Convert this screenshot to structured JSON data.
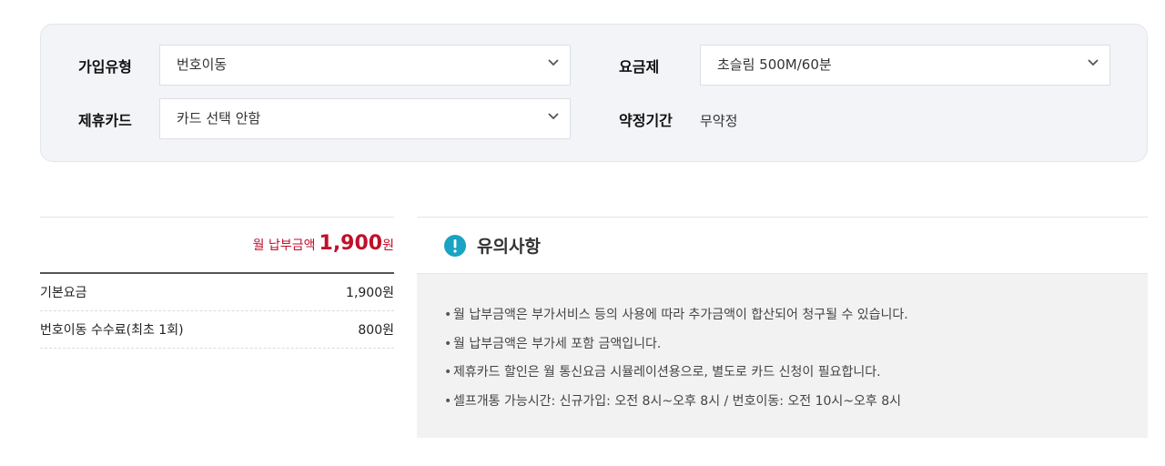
{
  "filters": {
    "join_type": {
      "label": "가입유형",
      "value": "번호이동"
    },
    "plan": {
      "label": "요금제",
      "value": "초슬림 500M/60분"
    },
    "card": {
      "label": "제휴카드",
      "value": "카드 선택 안함"
    },
    "contract": {
      "label": "약정기간",
      "value": "무약정"
    }
  },
  "summary": {
    "total_label": "월 납부금액",
    "total_amount": "1,900",
    "total_unit": "원",
    "rows": [
      {
        "label": "기본요금",
        "value": "1,900원"
      },
      {
        "label": "번호이동 수수료(최초 1회)",
        "value": "800원"
      }
    ]
  },
  "notice": {
    "icon": "exclamation-circle-icon",
    "title": "유의사항",
    "items": [
      "월 납부금액은 부가서비스 등의 사용에 따라 추가금액이 합산되어 청구될 수 있습니다.",
      "월 납부금액은 부가세 포함 금액입니다.",
      "제휴카드 할인은 월 통신요금 시뮬레이션용으로, 별도로 카드 신청이 필요합니다.",
      "셀프개통 가능시간: 신규가입: 오전 8시~오후 8시 / 번호이동: 오전 10시~오후 8시"
    ]
  },
  "colors": {
    "accent_red": "#c0102b",
    "info_teal": "#1aa3c2",
    "panel_bg": "#f2f4f7"
  }
}
